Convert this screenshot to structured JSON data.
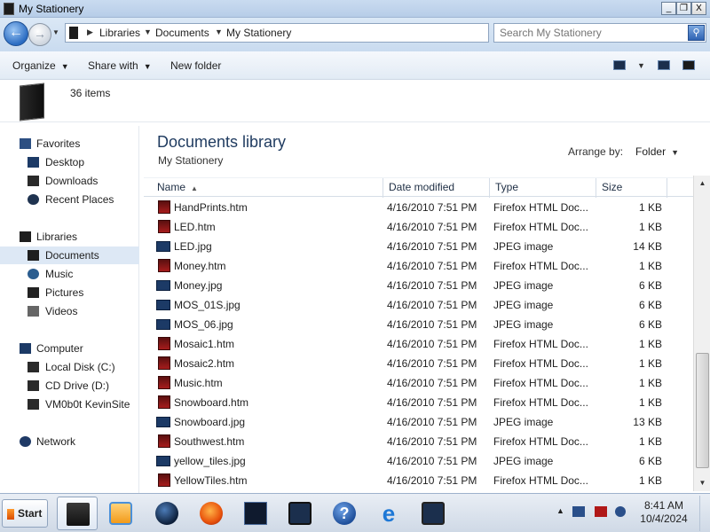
{
  "window": {
    "title": "My Stationery",
    "controls": {
      "minimize": "_",
      "maximize": "❐",
      "close": "X"
    }
  },
  "address": {
    "crumbs": [
      "Libraries",
      "Documents",
      "My Stationery"
    ],
    "search_placeholder": "Search My Stationery"
  },
  "toolbar": {
    "organize": "Organize",
    "share_with": "Share with",
    "new_folder": "New folder"
  },
  "info": {
    "item_count": "36 items"
  },
  "nav": {
    "items": [
      {
        "label": "Favorites",
        "icon": "star-icon"
      },
      {
        "label": "Desktop",
        "icon": "desktop-icon"
      },
      {
        "label": "Downloads",
        "icon": "downloads-icon"
      },
      {
        "label": "Recent Places",
        "icon": "recent-places-icon"
      },
      {
        "label": "Libraries",
        "icon": "libraries-icon"
      },
      {
        "label": "Documents",
        "icon": "documents-icon"
      },
      {
        "label": "Music",
        "icon": "music-icon"
      },
      {
        "label": "Pictures",
        "icon": "pictures-icon"
      },
      {
        "label": "Videos",
        "icon": "videos-icon"
      },
      {
        "label": "Computer",
        "icon": "computer-icon"
      },
      {
        "label": "Local Disk (C:)",
        "icon": "local-disk-icon"
      },
      {
        "label": "CD Drive (D:)",
        "icon": "cd-drive-icon"
      },
      {
        "label": "VM0b0t KevinSite",
        "icon": "network-drive-icon"
      },
      {
        "label": "Network",
        "icon": "network-icon"
      }
    ],
    "selected": "Documents"
  },
  "content": {
    "library_title": "Documents library",
    "library_subtitle": "My Stationery",
    "arrange_label": "Arrange by:",
    "arrange_value": "Folder"
  },
  "columns": {
    "name": "Name",
    "date": "Date modified",
    "type": "Type",
    "size": "Size"
  },
  "files": [
    {
      "name": "HandPrints.htm",
      "date": "4/16/2010 7:51 PM",
      "type": "Firefox HTML Doc...",
      "size": "1 KB",
      "kind": "htm"
    },
    {
      "name": "LED.htm",
      "date": "4/16/2010 7:51 PM",
      "type": "Firefox HTML Doc...",
      "size": "1 KB",
      "kind": "htm"
    },
    {
      "name": "LED.jpg",
      "date": "4/16/2010 7:51 PM",
      "type": "JPEG image",
      "size": "14 KB",
      "kind": "jpg"
    },
    {
      "name": "Money.htm",
      "date": "4/16/2010 7:51 PM",
      "type": "Firefox HTML Doc...",
      "size": "1 KB",
      "kind": "htm"
    },
    {
      "name": "Money.jpg",
      "date": "4/16/2010 7:51 PM",
      "type": "JPEG image",
      "size": "6 KB",
      "kind": "jpg"
    },
    {
      "name": "MOS_01S.jpg",
      "date": "4/16/2010 7:51 PM",
      "type": "JPEG image",
      "size": "6 KB",
      "kind": "jpg"
    },
    {
      "name": "MOS_06.jpg",
      "date": "4/16/2010 7:51 PM",
      "type": "JPEG image",
      "size": "6 KB",
      "kind": "jpg"
    },
    {
      "name": "Mosaic1.htm",
      "date": "4/16/2010 7:51 PM",
      "type": "Firefox HTML Doc...",
      "size": "1 KB",
      "kind": "htm"
    },
    {
      "name": "Mosaic2.htm",
      "date": "4/16/2010 7:51 PM",
      "type": "Firefox HTML Doc...",
      "size": "1 KB",
      "kind": "htm"
    },
    {
      "name": "Music.htm",
      "date": "4/16/2010 7:51 PM",
      "type": "Firefox HTML Doc...",
      "size": "1 KB",
      "kind": "htm"
    },
    {
      "name": "Snowboard.htm",
      "date": "4/16/2010 7:51 PM",
      "type": "Firefox HTML Doc...",
      "size": "1 KB",
      "kind": "htm"
    },
    {
      "name": "Snowboard.jpg",
      "date": "4/16/2010 7:51 PM",
      "type": "JPEG image",
      "size": "13 KB",
      "kind": "jpg"
    },
    {
      "name": "Southwest.htm",
      "date": "4/16/2010 7:51 PM",
      "type": "Firefox HTML Doc...",
      "size": "1 KB",
      "kind": "htm"
    },
    {
      "name": "yellow_tiles.jpg",
      "date": "4/16/2010 7:51 PM",
      "type": "JPEG image",
      "size": "6 KB",
      "kind": "jpg"
    },
    {
      "name": "YellowTiles.htm",
      "date": "4/16/2010 7:51 PM",
      "type": "Firefox HTML Doc...",
      "size": "1 KB",
      "kind": "htm"
    }
  ],
  "taskbar": {
    "start_label": "Start",
    "apps": [
      "explorer-icon",
      "media-player-icon",
      "globe-icon",
      "firefox-icon",
      "task-manager-icon",
      "remote-desktop-icon",
      "help-icon",
      "internet-explorer-icon",
      "network-app-icon"
    ],
    "clock_time": "8:41 AM",
    "clock_date": "10/4/2024"
  },
  "colors": {
    "accent": "#2b6cc2",
    "selection": "#dde8f5",
    "htm_icon": "#a61c1c",
    "jpg_icon": "#1c3a66"
  }
}
